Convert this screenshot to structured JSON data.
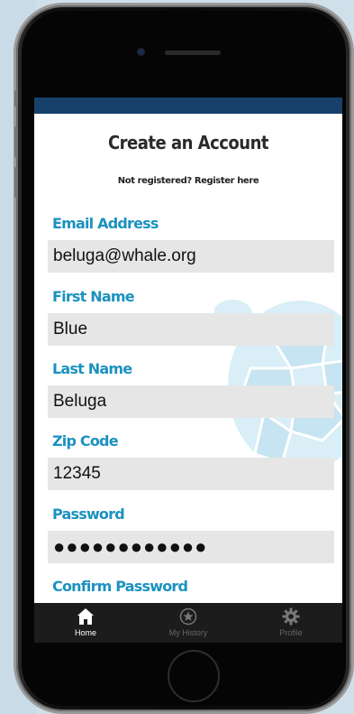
{
  "form": {
    "title": "Create an Account",
    "subtitle": "Not registered? Register here",
    "fields": [
      {
        "label": "Email Address",
        "value": "beluga@whale.org"
      },
      {
        "label": "First Name",
        "value": "Blue"
      },
      {
        "label": "Last Name",
        "value": "Beluga"
      },
      {
        "label": "Zip Code",
        "value": "12345"
      },
      {
        "label": "Password",
        "value": "●●●●●●●●●●●●"
      },
      {
        "label": "Confirm Password",
        "value": ""
      }
    ]
  },
  "tabbar": {
    "tabs": [
      {
        "label": "Home",
        "icon": "home-icon",
        "active": true
      },
      {
        "label": "My History",
        "icon": "star-circle-icon",
        "active": false
      },
      {
        "label": "Profile",
        "icon": "gear-icon",
        "active": false
      }
    ]
  },
  "colors": {
    "accent": "#1b92c0",
    "status_bar": "#17416a",
    "field_bg": "#e6e6e6",
    "tabbar_bg": "#1c1c1c"
  }
}
